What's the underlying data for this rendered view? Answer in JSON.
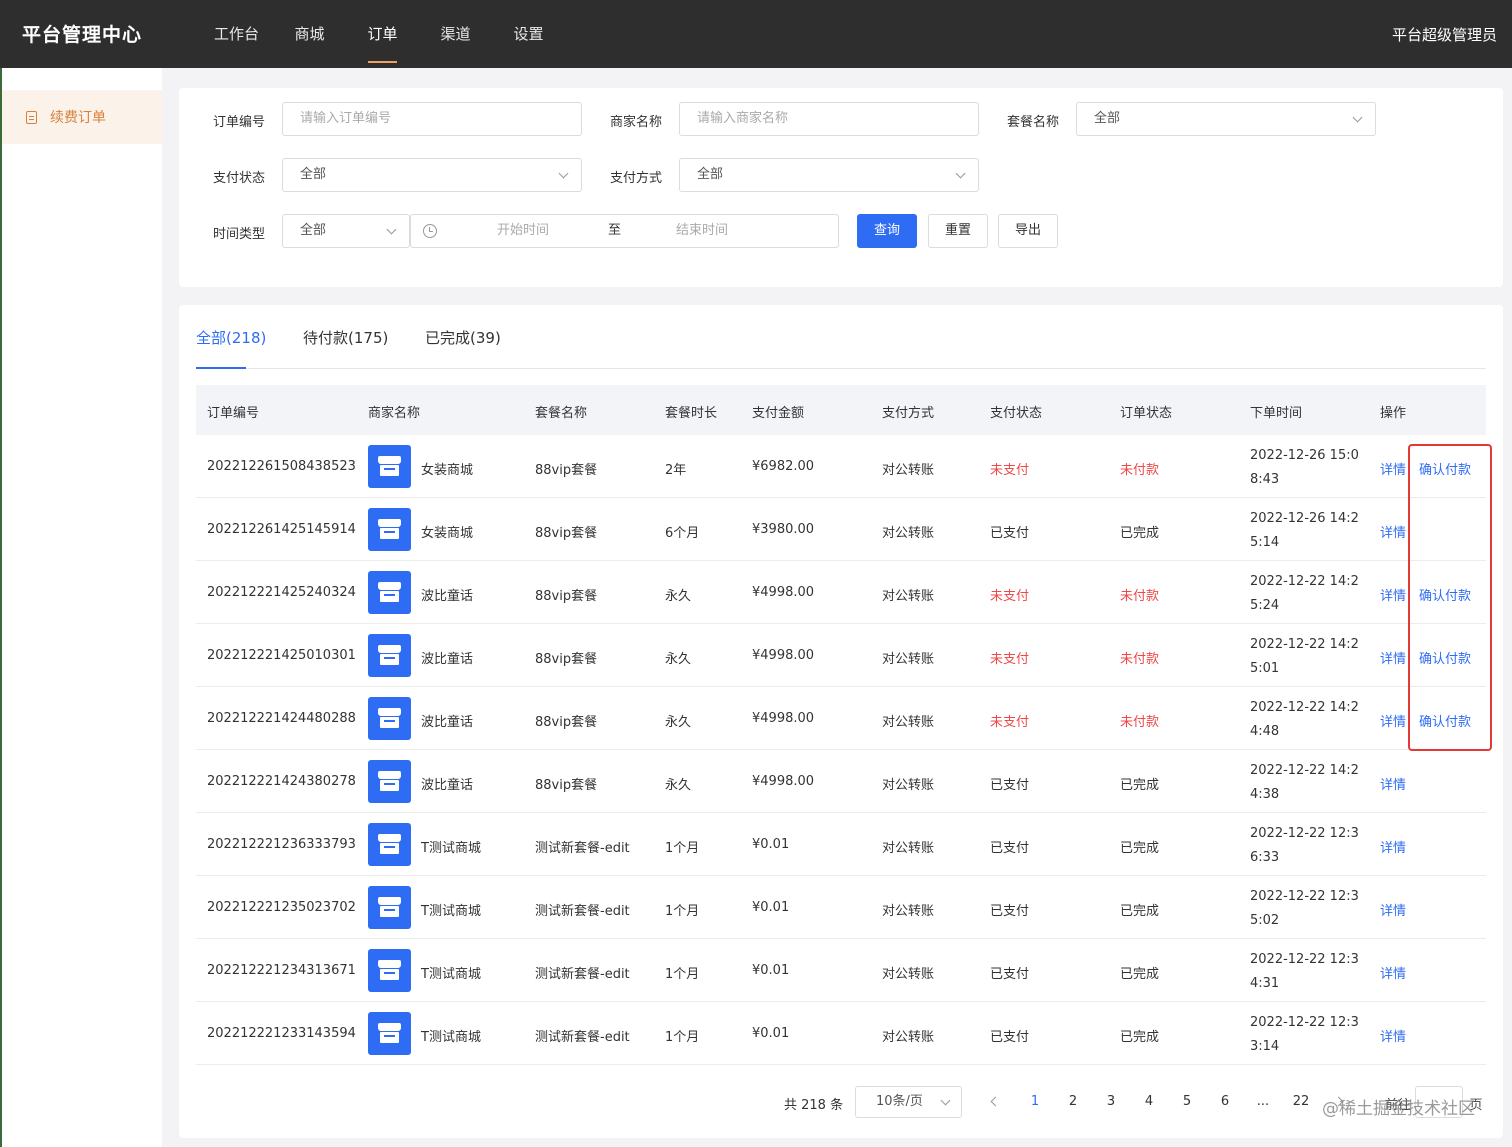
{
  "header": {
    "brand": "平台管理中心",
    "nav": [
      "工作台",
      "商城",
      "订单",
      "渠道",
      "设置"
    ],
    "active_nav": "订单",
    "user": "平台超级管理员"
  },
  "sidebar": {
    "items": [
      {
        "label": "续费订单",
        "icon": "document-icon"
      }
    ]
  },
  "filters": {
    "order_no_label": "订单编号",
    "order_no_placeholder": "请输入订单编号",
    "merchant_label": "商家名称",
    "merchant_placeholder": "请输入商家名称",
    "package_label": "套餐名称",
    "package_value": "全部",
    "pay_status_label": "支付状态",
    "pay_status_value": "全部",
    "pay_method_label": "支付方式",
    "pay_method_value": "全部",
    "time_type_label": "时间类型",
    "time_type_value": "全部",
    "start_placeholder": "开始时间",
    "range_separator": "至",
    "end_placeholder": "结束时间",
    "query": "查询",
    "reset": "重置",
    "export": "导出"
  },
  "tabs": [
    "全部(218)",
    "待付款(175)",
    "已完成(39)"
  ],
  "columns": [
    "订单编号",
    "商家名称",
    "套餐名称",
    "套餐时长",
    "支付金额",
    "支付方式",
    "支付状态",
    "订单状态",
    "下单时间",
    "操作"
  ],
  "rows": [
    {
      "order_no": "202212261508438523",
      "merchant": "女装商城",
      "package": "88vip套餐",
      "duration": "2年",
      "amount": "¥6982.00",
      "method": "对公转账",
      "pay_status": "未支付",
      "order_status": "未付款",
      "time": "2022-12-26 15:08:43",
      "detail": "详情",
      "confirm": "确认付款",
      "unpaid": true
    },
    {
      "order_no": "202212261425145914",
      "merchant": "女装商城",
      "package": "88vip套餐",
      "duration": "6个月",
      "amount": "¥3980.00",
      "method": "对公转账",
      "pay_status": "已支付",
      "order_status": "已完成",
      "time": "2022-12-26 14:25:14",
      "detail": "详情",
      "confirm": "",
      "unpaid": false
    },
    {
      "order_no": "202212221425240324",
      "merchant": "波比童话",
      "package": "88vip套餐",
      "duration": "永久",
      "amount": "¥4998.00",
      "method": "对公转账",
      "pay_status": "未支付",
      "order_status": "未付款",
      "time": "2022-12-22 14:25:24",
      "detail": "详情",
      "confirm": "确认付款",
      "unpaid": true
    },
    {
      "order_no": "202212221425010301",
      "merchant": "波比童话",
      "package": "88vip套餐",
      "duration": "永久",
      "amount": "¥4998.00",
      "method": "对公转账",
      "pay_status": "未支付",
      "order_status": "未付款",
      "time": "2022-12-22 14:25:01",
      "detail": "详情",
      "confirm": "确认付款",
      "unpaid": true
    },
    {
      "order_no": "202212221424480288",
      "merchant": "波比童话",
      "package": "88vip套餐",
      "duration": "永久",
      "amount": "¥4998.00",
      "method": "对公转账",
      "pay_status": "未支付",
      "order_status": "未付款",
      "time": "2022-12-22 14:24:48",
      "detail": "详情",
      "confirm": "确认付款",
      "unpaid": true
    },
    {
      "order_no": "202212221424380278",
      "merchant": "波比童话",
      "package": "88vip套餐",
      "duration": "永久",
      "amount": "¥4998.00",
      "method": "对公转账",
      "pay_status": "已支付",
      "order_status": "已完成",
      "time": "2022-12-22 14:24:38",
      "detail": "详情",
      "confirm": "",
      "unpaid": false
    },
    {
      "order_no": "202212221236333793",
      "merchant": "T测试商城",
      "package": "测试新套餐-edit",
      "duration": "1个月",
      "amount": "¥0.01",
      "method": "对公转账",
      "pay_status": "已支付",
      "order_status": "已完成",
      "time": "2022-12-22 12:36:33",
      "detail": "详情",
      "confirm": "",
      "unpaid": false
    },
    {
      "order_no": "202212221235023702",
      "merchant": "T测试商城",
      "package": "测试新套餐-edit",
      "duration": "1个月",
      "amount": "¥0.01",
      "method": "对公转账",
      "pay_status": "已支付",
      "order_status": "已完成",
      "time": "2022-12-22 12:35:02",
      "detail": "详情",
      "confirm": "",
      "unpaid": false
    },
    {
      "order_no": "202212221234313671",
      "merchant": "T测试商城",
      "package": "测试新套餐-edit",
      "duration": "1个月",
      "amount": "¥0.01",
      "method": "对公转账",
      "pay_status": "已支付",
      "order_status": "已完成",
      "time": "2022-12-22 12:34:31",
      "detail": "详情",
      "confirm": "",
      "unpaid": false
    },
    {
      "order_no": "202212221233143594",
      "merchant": "T测试商城",
      "package": "测试新套餐-edit",
      "duration": "1个月",
      "amount": "¥0.01",
      "method": "对公转账",
      "pay_status": "已支付",
      "order_status": "已完成",
      "time": "2022-12-22 12:33:14",
      "detail": "详情",
      "confirm": "",
      "unpaid": false
    }
  ],
  "pagination": {
    "total": "共 218 条",
    "page_size": "10条/页",
    "pages": [
      "1",
      "2",
      "3",
      "4",
      "5",
      "6",
      "...",
      "22"
    ],
    "current": "1",
    "jump_label": "前往",
    "page_suffix": "页"
  },
  "watermark": "@稀土掘金技术社区",
  "colors": {
    "primary": "#2f6cf4",
    "danger": "#f04848",
    "accent": "#d8813d",
    "highlight": "#e53935"
  }
}
